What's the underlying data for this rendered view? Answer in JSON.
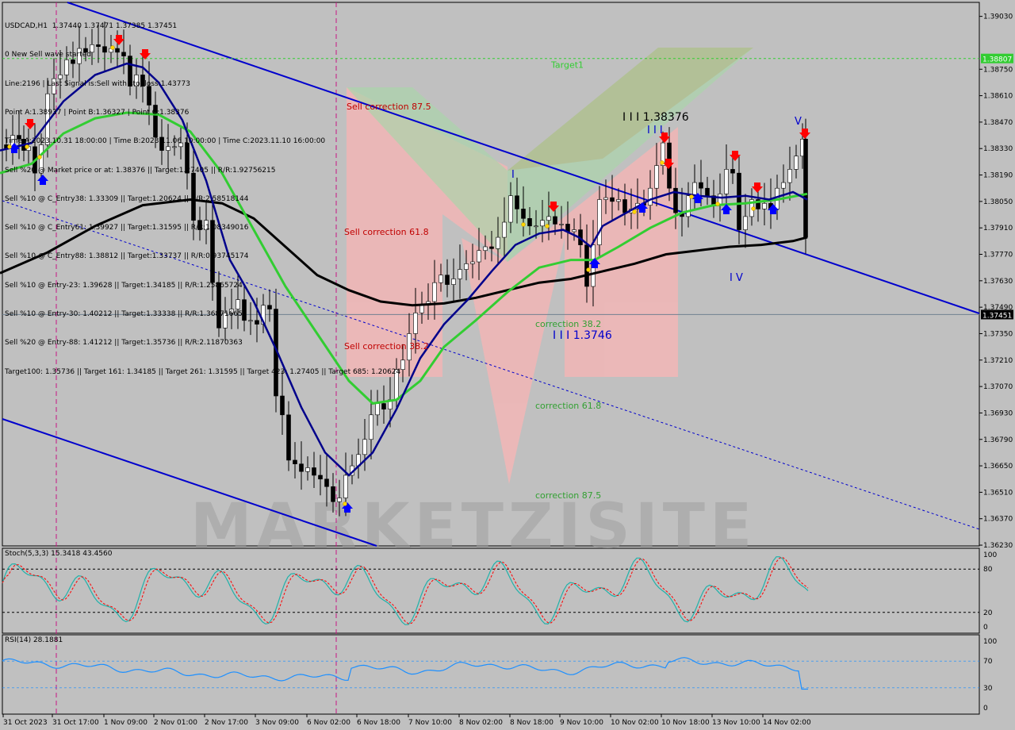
{
  "symbol": "USDCAD,H1",
  "ohlc": "1.37440 1.37471 1.37385 1.37451",
  "info_lines": [
    "0 New Sell wave started",
    "Line:2196 | Last Signal is:Sell with stoploss:1.43773",
    "Point A:1.38937 | Point B:1.36327 | Point C:1.38376",
    "Time A:2023.10.31 18:00:00 | Time B:2023.11.06 10:00:00 | Time C:2023.11.10 16:00:00",
    "Sell %20 @ Market price or at: 1.38376 || Target:1.27405 || R/R:1.92756215",
    "Sell %10 @ C_Entry38: 1.33309 || Target:1.20624 || R/R:2.58518144",
    "Sell %10 @ C_Entry61: 1.39927 || Target:1.31595 || R/R:1.08349016",
    "Sell %10 @ C_Entry88: 1.38812 || Target:1.33737 || R/R:0.93745174",
    "Sell %10 @ Entry-23: 1.39628 || Target:1.34185 || R/R:1.25865724",
    "Sell %10 @ Entry-30: 1.40212 || Target:1.33338 || R/R:1.36871665",
    "Sell %20 @ Entry-88: 1.41212 || Target:1.35736 || R/R:2.11870363",
    "Target100: 1.35736 || Target 161: 1.34185 || Target 261: 1.31595 || Target 423: 1.27405 || Target 685: 1.20624"
  ],
  "colors": {
    "background": "#c0c0c0",
    "bull_candle": "#ffffff",
    "bear_candle": "#000000",
    "ma_fast": "#00008b",
    "ma_mid": "#32cd32",
    "ma_slow": "#000000",
    "channel": "#0000cd",
    "osc_k": "#20b2aa",
    "osc_d": "#ff0000",
    "rsi": "#1e90ff",
    "target_line": "#32cd32",
    "price_tag": "#000000",
    "sell_arrow": "#ff0000",
    "buy_arrow": "#0000ff"
  },
  "labels": {
    "target1": "Target1",
    "sell_corr_875": "Sell correction 87.5",
    "sell_corr_618": "Sell correction 61.8",
    "sell_corr_382": "Sell correction 38.2",
    "corr_382": "correction 38.2",
    "corr_618": "correction 61.8",
    "corr_875": "correction 87.5",
    "point_c": "I I I 1.38376",
    "point_b": "I I I 1.3746",
    "wave_i": "I",
    "wave_iii": "I I I",
    "wave_iv": "I V",
    "wave_v": "V",
    "watermark": "MARKETZISITE"
  },
  "stoch": {
    "label": "Stoch(5,3,3) 15.3418 43.4560",
    "levels": [
      "100",
      "80",
      "20",
      "0"
    ]
  },
  "rsi": {
    "label": "RSI(14) 28.1881",
    "levels": [
      "100",
      "70",
      "30",
      "0"
    ]
  },
  "chart_data": {
    "type": "line",
    "title": "USDCAD,H1",
    "y_ticks": [
      1.3903,
      1.3875,
      1.3861,
      1.3847,
      1.3833,
      1.3819,
      1.3805,
      1.3791,
      1.3777,
      1.3763,
      1.3749,
      1.3735,
      1.3721,
      1.3707,
      1.3693,
      1.3679,
      1.3665,
      1.3651,
      1.3637,
      1.3623
    ],
    "y_tick_labels": [
      "1.39030",
      "1.38750",
      "1.38610",
      "1.38470",
      "1.38330",
      "1.38190",
      "1.38050",
      "1.37910",
      "1.37770",
      "1.37630",
      "1.37490",
      "1.37350",
      "1.37210",
      "1.37070",
      "1.36930",
      "1.36790",
      "1.36650",
      "1.36510",
      "1.36370",
      "1.36230"
    ],
    "ylim": [
      1.36226,
      1.39104
    ],
    "x_tick_labels": [
      "31 Oct 2023",
      "31 Oct 17:00",
      "1 Nov 09:00",
      "2 Nov 01:00",
      "2 Nov 17:00",
      "3 Nov 09:00",
      "6 Nov 02:00",
      "6 Nov 18:00",
      "7 Nov 10:00",
      "8 Nov 02:00",
      "8 Nov 18:00",
      "9 Nov 10:00",
      "10 Nov 02:00",
      "10 Nov 18:00",
      "13 Nov 10:00",
      "14 Nov 02:00"
    ],
    "current_price": 1.37451,
    "target1_price": 1.38807,
    "target1_label": "1.38807",
    "current_price_label": "1.37451",
    "close_path": [
      [
        0,
        1.3835
      ],
      [
        8,
        1.3833
      ],
      [
        16,
        1.384
      ],
      [
        24,
        1.3838
      ],
      [
        30,
        1.3832
      ],
      [
        36,
        1.3834
      ],
      [
        44,
        1.382
      ],
      [
        52,
        1.3835
      ],
      [
        60,
        1.3862
      ],
      [
        68,
        1.387
      ],
      [
        76,
        1.3872
      ],
      [
        84,
        1.388
      ],
      [
        92,
        1.3878
      ],
      [
        100,
        1.3886
      ],
      [
        108,
        1.3884
      ],
      [
        116,
        1.3888
      ],
      [
        124,
        1.3887
      ],
      [
        132,
        1.3884
      ],
      [
        140,
        1.3886
      ],
      [
        148,
        1.3884
      ],
      [
        156,
        1.3882
      ],
      [
        164,
        1.3866
      ],
      [
        172,
        1.3872
      ],
      [
        180,
        1.3866
      ],
      [
        188,
        1.3856
      ],
      [
        196,
        1.3839
      ],
      [
        204,
        1.3832
      ],
      [
        212,
        1.3834
      ],
      [
        220,
        1.3834
      ],
      [
        228,
        1.3836
      ],
      [
        236,
        1.382
      ],
      [
        244,
        1.3795
      ],
      [
        252,
        1.379
      ],
      [
        260,
        1.3795
      ],
      [
        268,
        1.3762
      ],
      [
        276,
        1.3738
      ],
      [
        284,
        1.3746
      ],
      [
        292,
        1.3748
      ],
      [
        300,
        1.3753
      ],
      [
        308,
        1.3742
      ],
      [
        316,
        1.3742
      ],
      [
        324,
        1.374
      ],
      [
        332,
        1.375
      ],
      [
        340,
        1.3748
      ],
      [
        348,
        1.3702
      ],
      [
        356,
        1.3692
      ],
      [
        364,
        1.3668
      ],
      [
        372,
        1.3666
      ],
      [
        380,
        1.3662
      ],
      [
        388,
        1.3664
      ],
      [
        396,
        1.366
      ],
      [
        404,
        1.3658
      ],
      [
        412,
        1.3654
      ],
      [
        420,
        1.3646
      ],
      [
        428,
        1.3648
      ],
      [
        436,
        1.366
      ],
      [
        444,
        1.3665
      ],
      [
        452,
        1.3671
      ],
      [
        460,
        1.3679
      ],
      [
        468,
        1.3692
      ],
      [
        476,
        1.3698
      ],
      [
        484,
        1.3695
      ],
      [
        492,
        1.37
      ],
      [
        500,
        1.3716
      ],
      [
        508,
        1.3721
      ],
      [
        516,
        1.3735
      ],
      [
        524,
        1.3746
      ],
      [
        532,
        1.375
      ],
      [
        540,
        1.3752
      ],
      [
        548,
        1.3762
      ],
      [
        556,
        1.3766
      ],
      [
        564,
        1.3761
      ],
      [
        572,
        1.3764
      ],
      [
        580,
        1.3769
      ],
      [
        588,
        1.3772
      ],
      [
        596,
        1.3773
      ],
      [
        604,
        1.3779
      ],
      [
        612,
        1.3781
      ],
      [
        620,
        1.378
      ],
      [
        628,
        1.3786
      ],
      [
        636,
        1.3794
      ],
      [
        644,
        1.3808
      ],
      [
        652,
        1.3801
      ],
      [
        660,
        1.3796
      ],
      [
        668,
        1.3792
      ],
      [
        676,
        1.3792
      ],
      [
        684,
        1.3795
      ],
      [
        692,
        1.3797
      ],
      [
        700,
        1.3793
      ],
      [
        708,
        1.3793
      ],
      [
        716,
        1.3789
      ],
      [
        724,
        1.379
      ],
      [
        732,
        1.3782
      ],
      [
        740,
        1.376
      ],
      [
        748,
        1.3782
      ],
      [
        756,
        1.3806
      ],
      [
        764,
        1.3807
      ],
      [
        772,
        1.3805
      ],
      [
        780,
        1.3806
      ],
      [
        788,
        1.3799
      ],
      [
        796,
        1.3801
      ],
      [
        804,
        1.3804
      ],
      [
        812,
        1.3803
      ],
      [
        820,
        1.3812
      ],
      [
        828,
        1.3824
      ],
      [
        836,
        1.3836
      ],
      [
        844,
        1.3812
      ],
      [
        852,
        1.3799
      ],
      [
        860,
        1.3797
      ],
      [
        868,
        1.3808
      ],
      [
        876,
        1.3815
      ],
      [
        884,
        1.3812
      ],
      [
        892,
        1.3808
      ],
      [
        900,
        1.3803
      ],
      [
        908,
        1.3809
      ],
      [
        916,
        1.3822
      ],
      [
        924,
        1.382
      ],
      [
        932,
        1.379
      ],
      [
        940,
        1.3797
      ],
      [
        948,
        1.3806
      ],
      [
        956,
        1.3801
      ],
      [
        964,
        1.3804
      ],
      [
        972,
        1.3801
      ],
      [
        980,
        1.3812
      ],
      [
        988,
        1.3815
      ],
      [
        996,
        1.3822
      ],
      [
        1004,
        1.3829
      ],
      [
        1012,
        1.3838
      ],
      [
        1016,
        1.3786
      ]
    ],
    "ma_fast": [
      [
        0,
        1.3832
      ],
      [
        40,
        1.3836
      ],
      [
        80,
        1.3858
      ],
      [
        120,
        1.3872
      ],
      [
        160,
        1.3878
      ],
      [
        180,
        1.3876
      ],
      [
        200,
        1.3868
      ],
      [
        230,
        1.3848
      ],
      [
        260,
        1.3816
      ],
      [
        290,
        1.3774
      ],
      [
        320,
        1.3752
      ],
      [
        350,
        1.3725
      ],
      [
        380,
        1.3696
      ],
      [
        410,
        1.3672
      ],
      [
        440,
        1.366
      ],
      [
        470,
        1.3672
      ],
      [
        500,
        1.3695
      ],
      [
        530,
        1.3722
      ],
      [
        560,
        1.374
      ],
      [
        590,
        1.3753
      ],
      [
        620,
        1.3768
      ],
      [
        650,
        1.3782
      ],
      [
        680,
        1.3788
      ],
      [
        710,
        1.379
      ],
      [
        730,
        1.3786
      ],
      [
        745,
        1.3781
      ],
      [
        760,
        1.3792
      ],
      [
        790,
        1.3799
      ],
      [
        820,
        1.3806
      ],
      [
        850,
        1.381
      ],
      [
        880,
        1.3808
      ],
      [
        910,
        1.3807
      ],
      [
        940,
        1.3808
      ],
      [
        970,
        1.3806
      ],
      [
        1000,
        1.381
      ],
      [
        1018,
        1.3806
      ]
    ],
    "ma_mid": [
      [
        0,
        1.382
      ],
      [
        40,
        1.3825
      ],
      [
        80,
        1.3841
      ],
      [
        120,
        1.3849
      ],
      [
        160,
        1.3852
      ],
      [
        200,
        1.3851
      ],
      [
        240,
        1.3842
      ],
      [
        280,
        1.382
      ],
      [
        320,
        1.379
      ],
      [
        360,
        1.376
      ],
      [
        400,
        1.3735
      ],
      [
        440,
        1.371
      ],
      [
        470,
        1.3698
      ],
      [
        500,
        1.37
      ],
      [
        530,
        1.371
      ],
      [
        560,
        1.3728
      ],
      [
        600,
        1.3742
      ],
      [
        640,
        1.3757
      ],
      [
        680,
        1.377
      ],
      [
        720,
        1.3774
      ],
      [
        750,
        1.3774
      ],
      [
        780,
        1.3781
      ],
      [
        820,
        1.3791
      ],
      [
        860,
        1.3799
      ],
      [
        900,
        1.3803
      ],
      [
        940,
        1.3804
      ],
      [
        980,
        1.3806
      ],
      [
        1018,
        1.3809
      ]
    ],
    "ma_slow": [
      [
        0,
        1.3767
      ],
      [
        60,
        1.3778
      ],
      [
        120,
        1.3792
      ],
      [
        180,
        1.3803
      ],
      [
        240,
        1.3806
      ],
      [
        280,
        1.3804
      ],
      [
        320,
        1.3796
      ],
      [
        360,
        1.3781
      ],
      [
        400,
        1.3766
      ],
      [
        440,
        1.3758
      ],
      [
        480,
        1.3752
      ],
      [
        520,
        1.375
      ],
      [
        560,
        1.3751
      ],
      [
        600,
        1.3754
      ],
      [
        640,
        1.3758
      ],
      [
        680,
        1.3762
      ],
      [
        720,
        1.3764
      ],
      [
        760,
        1.3768
      ],
      [
        800,
        1.3772
      ],
      [
        840,
        1.3777
      ],
      [
        880,
        1.3779
      ],
      [
        920,
        1.3781
      ],
      [
        960,
        1.3782
      ],
      [
        1000,
        1.3784
      ],
      [
        1018,
        1.3786
      ]
    ]
  }
}
